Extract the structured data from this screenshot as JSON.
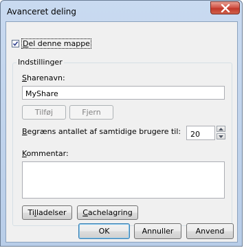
{
  "window": {
    "title": "Avanceret deling",
    "close_icon": "close-icon"
  },
  "share_checkbox": {
    "label": "Del denne mappe",
    "checked": true
  },
  "settings": {
    "group_label": "Indstillinger",
    "share_name_label": "Sharenavn:",
    "share_name_value": "MyShare",
    "add_button": "Tilføj",
    "remove_button": "Fjern",
    "limit_label": "Begræns antallet af samtidige brugere til:",
    "limit_value": "20",
    "comment_label": "Kommentar:",
    "comment_value": "",
    "permissions_button": "Tilladelser",
    "caching_button": "Cachelagring"
  },
  "footer": {
    "ok_button": "OK",
    "cancel_button": "Annuller",
    "apply_button": "Anvend"
  },
  "colors": {
    "title_bar": "#c9daf0",
    "client_bg": "#f0f0f0",
    "close_button": "#c1382a"
  }
}
